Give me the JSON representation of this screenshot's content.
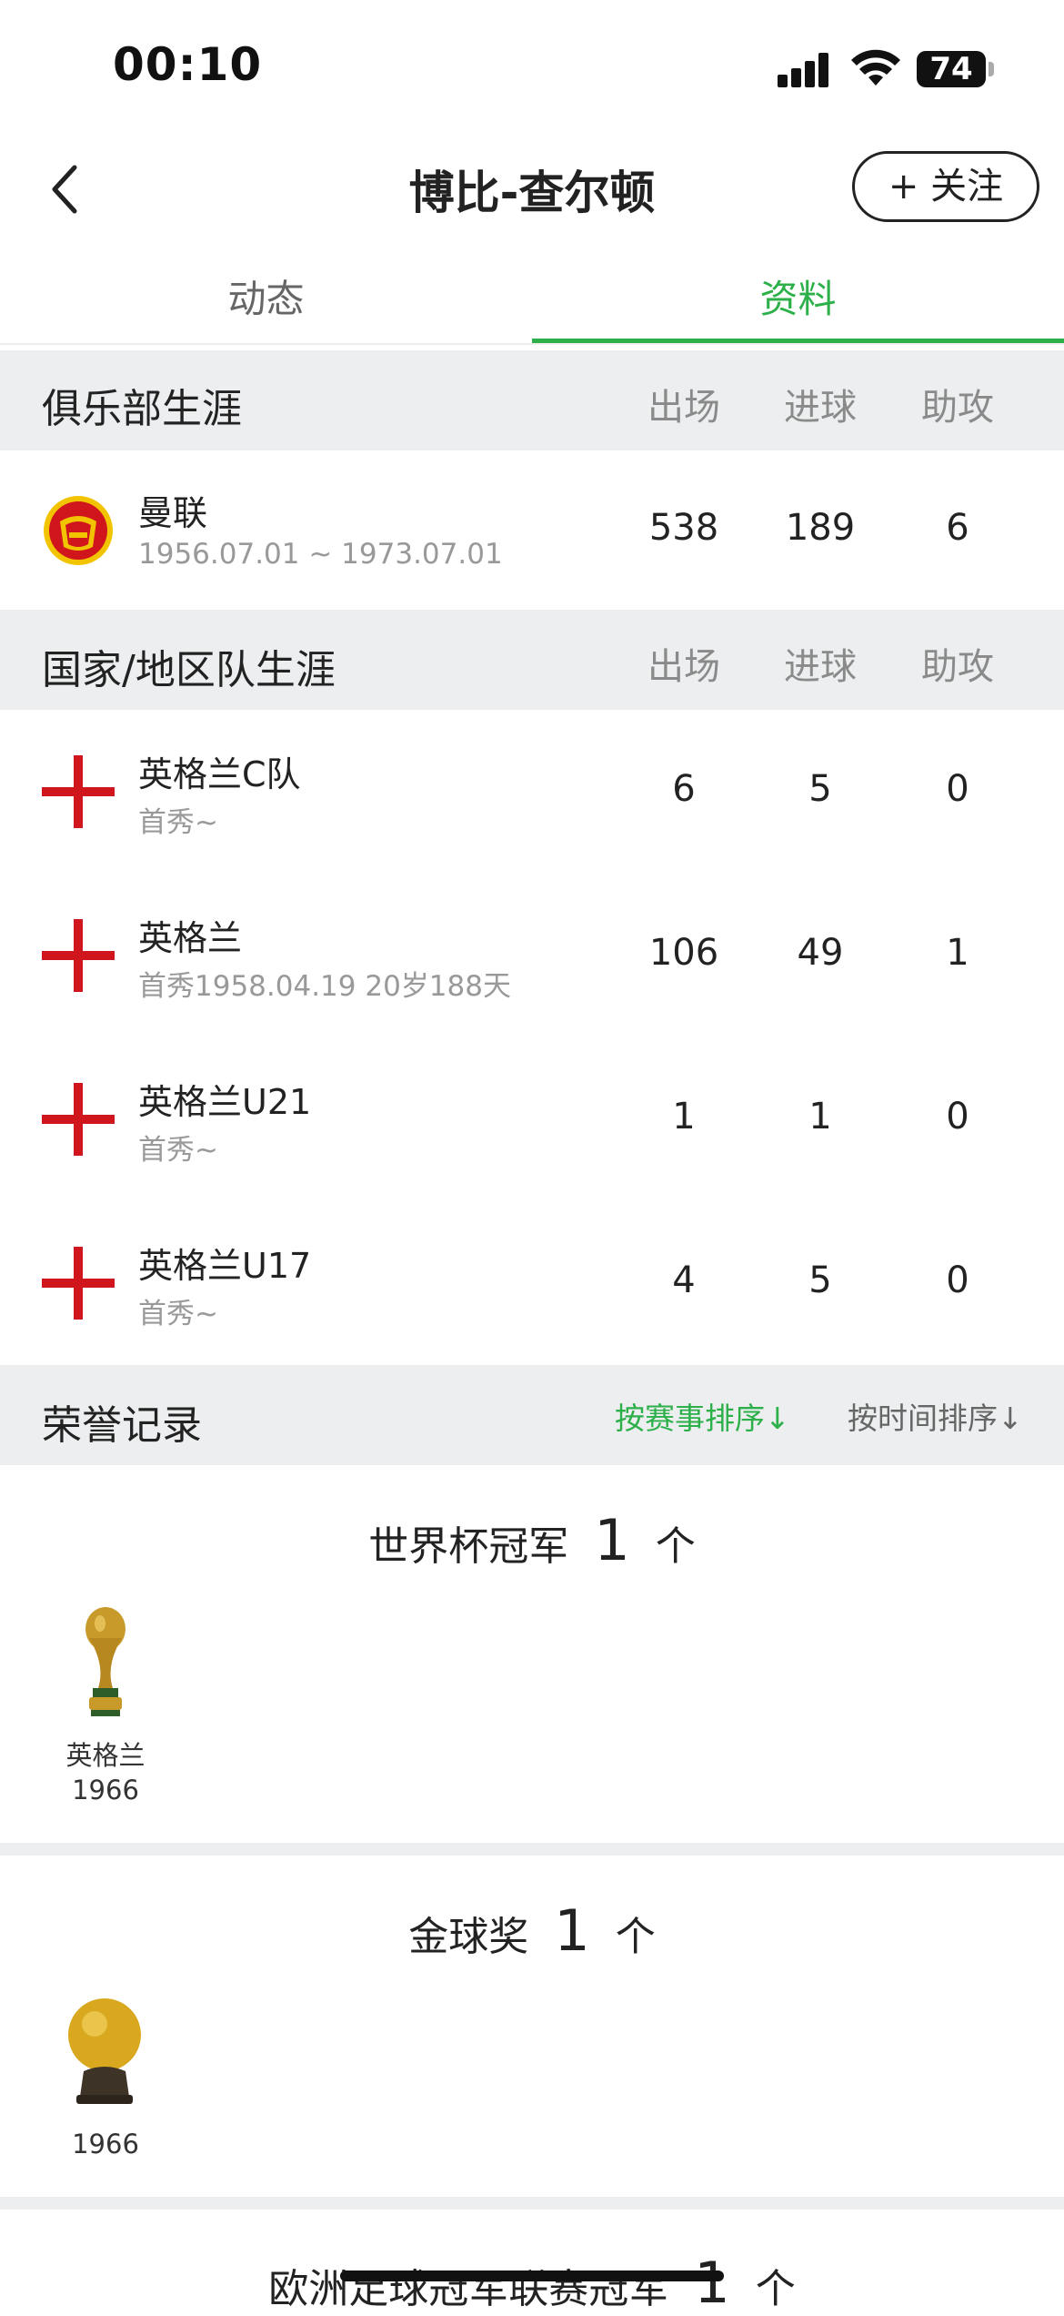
{
  "status": {
    "time": "00:10",
    "battery": "74"
  },
  "nav": {
    "title": "博比-查尔顿",
    "follow_label": "+ 关注"
  },
  "tabs": [
    {
      "label": "动态"
    },
    {
      "label": "资料"
    }
  ],
  "club_section": {
    "title": "俱乐部生涯",
    "columns": [
      "出场",
      "进球",
      "助攻"
    ],
    "rows": [
      {
        "name": "曼联",
        "sub": "1956.07.01 ~ 1973.07.01",
        "apps": "538",
        "goals": "189",
        "assists": "6",
        "icon": "man-utd-crest"
      }
    ]
  },
  "national_section": {
    "title": "国家/地区队生涯",
    "columns": [
      "出场",
      "进球",
      "助攻"
    ],
    "rows": [
      {
        "name": "英格兰C队",
        "sub": "首秀~",
        "apps": "6",
        "goals": "5",
        "assists": "0",
        "icon": "england-flag"
      },
      {
        "name": "英格兰",
        "sub": "首秀1958.04.19 20岁188天",
        "apps": "106",
        "goals": "49",
        "assists": "1",
        "icon": "england-flag"
      },
      {
        "name": "英格兰U21",
        "sub": "首秀~",
        "apps": "1",
        "goals": "1",
        "assists": "0",
        "icon": "england-flag"
      },
      {
        "name": "英格兰U17",
        "sub": "首秀~",
        "apps": "4",
        "goals": "5",
        "assists": "0",
        "icon": "england-flag"
      }
    ]
  },
  "honors": {
    "title": "荣誉记录",
    "sort_by_event": "按赛事排序↓",
    "sort_by_time": "按时间排序↓",
    "groups": [
      {
        "name": "世界杯冠军",
        "count": "1",
        "unit": "个",
        "items": [
          {
            "label": "英格兰",
            "year": "1966",
            "icon": "world-cup-trophy"
          }
        ]
      },
      {
        "name": "金球奖",
        "count": "1",
        "unit": "个",
        "items": [
          {
            "label": "",
            "year": "1966",
            "icon": "golden-ball"
          }
        ]
      },
      {
        "name": "欧洲足球冠军联赛冠军",
        "count": "1",
        "unit": "个",
        "items": []
      }
    ]
  }
}
